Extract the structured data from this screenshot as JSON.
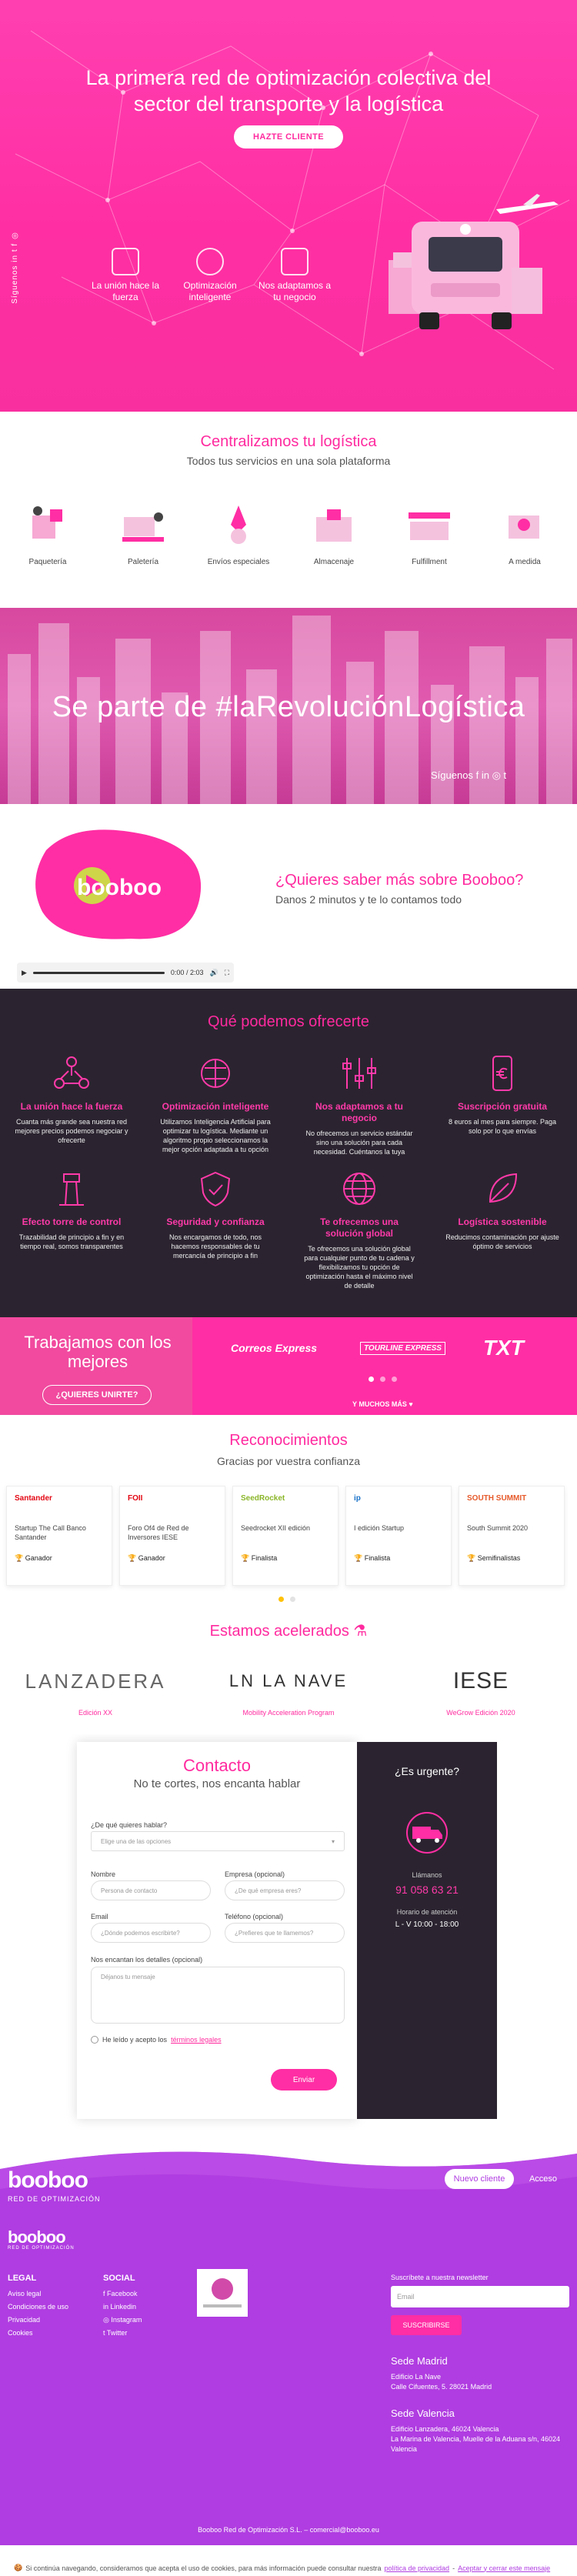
{
  "hero": {
    "title": "La primera red de optimización colectiva del sector del transporte y la logística",
    "cta": "HAZTE CLIENTE",
    "social_label": "Síguenos",
    "features": [
      {
        "label": "La unión hace la fuerza",
        "icon": "handshake-icon"
      },
      {
        "label": "Optimización inteligente",
        "icon": "brain-icon"
      },
      {
        "label": "Nos adaptamos a tu negocio",
        "icon": "boxes-icon"
      }
    ],
    "colors": {
      "primary": "#ff2ea4"
    }
  },
  "central": {
    "title": "Centralizamos tu logística",
    "subtitle": "Todos tus servicios en una sola plataforma",
    "services": [
      {
        "label": "Paquetería",
        "icon": "parcel-icon"
      },
      {
        "label": "Paletería",
        "icon": "pallet-icon"
      },
      {
        "label": "Envíos especiales",
        "icon": "rocket-icon"
      },
      {
        "label": "Almacenaje",
        "icon": "warehouse-icon"
      },
      {
        "label": "Fulfillment",
        "icon": "fulfillment-icon"
      },
      {
        "label": "A medida",
        "icon": "custom-icon"
      }
    ]
  },
  "revol": {
    "title": "Se parte de #laRevoluciónLogística",
    "siguenos": "Síguenos"
  },
  "video": {
    "question": "¿Quieres saber más sobre Booboo?",
    "subtitle": "Danos 2 minutos y te lo contamos todo",
    "logo_text": "booboo",
    "time": "0:00 / 2:03"
  },
  "ofrecer": {
    "title": "Qué podemos ofrecerte",
    "items": [
      {
        "title": "La unión hace la fuerza",
        "desc": "Cuanta más grande sea nuestra red mejores precios podemos negociar y ofrecerte",
        "icon": "network-icon"
      },
      {
        "title": "Optimización inteligente",
        "desc": "Utilizamos Inteligencia Artificial para optimizar tu logística. Mediante un algoritmo propio seleccionamos la mejor opción adaptada a tu opción",
        "icon": "brain-icon"
      },
      {
        "title": "Nos adaptamos a tu negocio",
        "desc": "No ofrecemos un servicio estándar sino una solución para cada necesidad. Cuéntanos la tuya",
        "icon": "sliders-icon"
      },
      {
        "title": "Suscripción gratuita",
        "desc": "8 euros al mes para siempre. Paga solo por lo que envías",
        "icon": "phone-euro-icon"
      },
      {
        "title": "Efecto torre de control",
        "desc": "Trazabilidad de principio a fin y en tiempo real, somos transparentes",
        "icon": "tower-icon"
      },
      {
        "title": "Seguridad y confianza",
        "desc": "Nos encargamos de todo, nos hacemos responsables de tu mercancía de principio a fin",
        "icon": "shield-icon"
      },
      {
        "title": "Te ofrecemos una solución global",
        "desc": "Te ofrecemos una solución global para cualquier punto de tu cadena y flexibilizamos tu opción de optimización hasta el máximo nivel de detalle",
        "icon": "globe-icon"
      },
      {
        "title": "Logística sostenible",
        "desc": "Reducimos contaminación por ajuste óptimo de servicios",
        "icon": "leaf-icon"
      }
    ]
  },
  "trabajo": {
    "title": "Trabajamos con los mejores",
    "cta": "¿QUIERES UNIRTE?",
    "logos": [
      "Correos Express",
      "TOURLINE EXPRESS",
      "TXT"
    ],
    "more": "Y MUCHOS MÁS ♥"
  },
  "recon": {
    "title": "Reconocimientos",
    "subtitle": "Gracias por vuestra confianza",
    "cards": [
      {
        "logo": "Santander",
        "text": "Startup The Call Banco Santander",
        "badge": "Ganador"
      },
      {
        "logo": "FOII",
        "text": "Foro Of4 de Red de Inversores IESE",
        "badge": "Ganador"
      },
      {
        "logo": "SeedRocket",
        "text": "Seedrocket XII edición",
        "badge": "Finalista"
      },
      {
        "logo": "ip",
        "text": "I edición Startup",
        "badge": "Finalista"
      },
      {
        "logo": "SOUTH SUMMIT",
        "text": "South Summit 2020",
        "badge": "Semifinalistas"
      }
    ]
  },
  "acel": {
    "title": "Estamos acelerados",
    "items": [
      {
        "logo": "LANZADERA",
        "label": "Edición XX"
      },
      {
        "logo": "LN LA NAVE",
        "label": "Mobility Acceleration Program"
      },
      {
        "logo": "IESE",
        "label": "WeGrow Edición 2020"
      }
    ]
  },
  "contacto": {
    "title": "Contacto",
    "subtitle": "No te cortes, nos encanta hablar",
    "q_label": "¿De qué quieres hablar?",
    "q_placeholder": "Elige una de las opciones",
    "name_label": "Nombre",
    "name_ph": "Persona de contacto",
    "company_label": "Empresa (opcional)",
    "company_ph": "¿De qué empresa eres?",
    "email_label": "Email",
    "email_ph": "¿Dónde podemos escribirte?",
    "phone_label": "Teléfono (opcional)",
    "phone_ph": "¿Prefieres que te llamemos?",
    "details_label": "Nos encantan los detalles (opcional)",
    "details_ph": "Déjanos tu mensaje",
    "terms": "He leído y acepto los",
    "terms_link": "términos legales",
    "send": "Enviar",
    "urgent_title": "¿Es urgente?",
    "urgent_call": "Llámanos",
    "urgent_phone": "91 058 63 21",
    "urgent_hours_label": "Horario de atención",
    "urgent_hours": "L - V 10:00 - 18:00"
  },
  "footer": {
    "brand": "booboo",
    "brand_sub": "RED DE OPTIMIZACIÓN",
    "nuevo": "Nuevo cliente",
    "acceso": "Acceso",
    "legal_title": "LEGAL",
    "legal": [
      "Aviso legal",
      "Condiciones de uso",
      "Privacidad",
      "Cookies"
    ],
    "social_title": "SOCIAL",
    "social": [
      "Facebook",
      "Linkedin",
      "Instagram",
      "Twitter"
    ],
    "newsletter": "Suscríbete a nuestra newsletter",
    "newsletter_ph": "Email",
    "subscribe": "SUSCRIBIRSE",
    "madrid_title": "Sede Madrid",
    "madrid_addr": "Edificio La Nave\nCalle Cifuentes, 5. 28021 Madrid",
    "valencia_title": "Sede Valencia",
    "valencia_addr": "Edificio Lanzadera, 46024 Valencia\nLa Marina de Valencia, Muelle de la Aduana s/n, 46024 Valencia",
    "copyright": "Booboo Red de Optimización S.L. – comercial@booboo.eu",
    "colors": {
      "footer": "#b03de1"
    }
  },
  "cookie": {
    "text": "Si continúa navegando, consideramos que acepta el uso de cookies, para más información puede consultar nuestra",
    "policy": "política de privacidad",
    "sep": "-",
    "accept": "Aceptar y cerrar este mensaje"
  }
}
